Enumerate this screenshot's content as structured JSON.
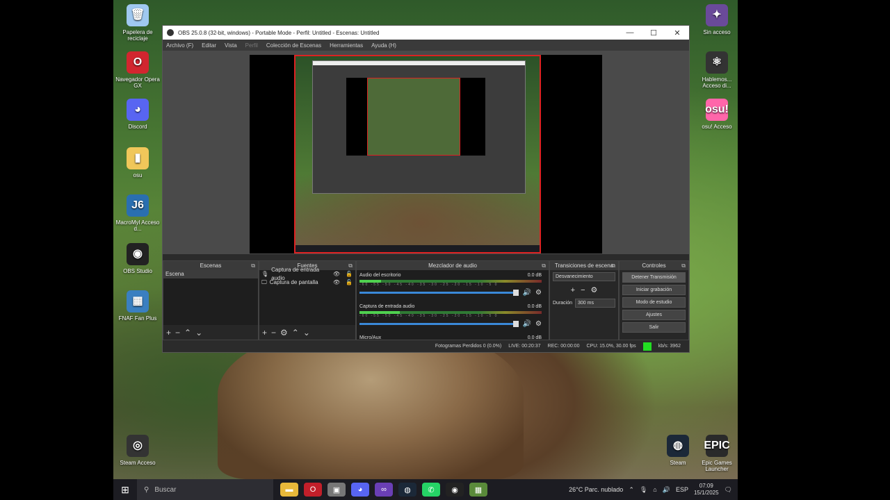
{
  "desktop": {
    "icons_left": [
      {
        "label": "Papelera de reciclaje",
        "icon": "recycle-bin-icon",
        "color": "#9fc8f0",
        "glyph": "🗑"
      },
      {
        "label": "Navegador Opera GX",
        "icon": "opera-icon",
        "color": "#d2262f",
        "glyph": "O"
      },
      {
        "label": "Discord",
        "icon": "discord-icon",
        "color": "#5865f2",
        "glyph": "◕"
      },
      {
        "label": "osu",
        "icon": "folder-icon",
        "color": "#f0c75a",
        "glyph": "▮"
      },
      {
        "label": "MacroMyl Acceso d...",
        "icon": "macro-app-icon",
        "color": "#2a6fb0",
        "glyph": "J6"
      },
      {
        "label": "OBS Studio",
        "icon": "obs-icon",
        "color": "#222222",
        "glyph": "◉"
      },
      {
        "label": "FNAF Fan Plus",
        "icon": "game-icon",
        "color": "#3a7fc0",
        "glyph": "▦"
      },
      {
        "label": "Steam Acceso",
        "icon": "user-circle-icon",
        "color": "#333333",
        "glyph": "◎"
      }
    ],
    "icons_right": [
      {
        "label": "Sin acceso",
        "icon": "app-icon",
        "color": "#6a4a9a",
        "glyph": "✦"
      },
      {
        "label": "Hablemos... Acceso di...",
        "icon": "atom-icon",
        "color": "#333333",
        "glyph": "⚛"
      },
      {
        "label": "osu! Acceso",
        "icon": "osu-icon",
        "color": "#ff66aa",
        "glyph": "osu!"
      },
      {
        "label": "Steam",
        "icon": "steam-icon",
        "color": "#1b2838",
        "glyph": "◍"
      },
      {
        "label": "Epic Games Launcher",
        "icon": "epic-games-icon",
        "color": "#2a2a2a",
        "glyph": "EPIC"
      }
    ]
  },
  "obs": {
    "title": "OBS 25.0.8 (32-bit, windows) - Portable Mode - Perfil: Untitled - Escenas: Untitled",
    "window_controls": [
      "—",
      "☐",
      "✕"
    ],
    "menu": [
      "Archivo (F)",
      "Editar",
      "Vista",
      "Perfil",
      "Colección de Escenas",
      "Herramientas",
      "Ayuda (H)"
    ],
    "docks": {
      "scenes": {
        "title": "Escenas",
        "items": [
          "Escena"
        ]
      },
      "sources": {
        "title": "Fuentes",
        "items": [
          "Captura de entrada audio",
          "Captura de pantalla"
        ]
      },
      "mixer": {
        "title": "Mezclador de audio",
        "channels": [
          {
            "name": "Audio del escritorio",
            "db": "0.0 dB",
            "level": 0.12
          },
          {
            "name": "Captura de entrada audio",
            "db": "0.0 dB",
            "level": 0.22
          },
          {
            "name": "Micro/Aux",
            "db": "0.0 dB",
            "level": 0.0
          }
        ],
        "ticks": "-60 -55 -50 -45 -40 -35 -30 -25 -20 -15 -10 -5 0"
      },
      "transitions": {
        "title": "Transiciones de escena",
        "type": "Desvanecimiento",
        "duration_label": "Duración",
        "duration": "300 ms"
      },
      "controls": {
        "title": "Controles",
        "buttons": [
          "Detener Transmisión",
          "Iniciar grabación",
          "Modo de estudio",
          "Ajustes",
          "Salir"
        ]
      }
    },
    "status": {
      "dropped": "Fotogramas Perdidos 0 (0.0%)",
      "live": "LIVE: 00:20:37",
      "rec": "REC: 00:00:00",
      "cpu": "CPU: 15.0%, 30.00 fps",
      "kbps": "kb/s: 3962",
      "indicator_color": "#22dd22"
    }
  },
  "taskbar": {
    "start": "⊞",
    "search_placeholder": "Buscar",
    "apps": [
      {
        "icon": "file-explorer-icon",
        "color": "#e8b83a",
        "glyph": "▬"
      },
      {
        "icon": "opera-taskbar-icon",
        "color": "#c21f2a",
        "glyph": "O"
      },
      {
        "icon": "app-taskbar-icon",
        "color": "#777777",
        "glyph": "▣"
      },
      {
        "icon": "discord-taskbar-icon",
        "color": "#5865f2",
        "glyph": "◕"
      },
      {
        "icon": "visual-studio-icon",
        "color": "#6a3fb5",
        "glyph": "∞"
      },
      {
        "icon": "steam-taskbar-icon",
        "color": "#1b2838",
        "glyph": "◍"
      },
      {
        "icon": "whatsapp-icon",
        "color": "#25d366",
        "glyph": "✆"
      },
      {
        "icon": "obs-taskbar-icon",
        "color": "#222222",
        "glyph": "◉"
      },
      {
        "icon": "minecraft-icon",
        "color": "#5a8a3a",
        "glyph": "▦"
      }
    ],
    "weather": "26°C  Parc. nublado",
    "lang": "ESP",
    "time": "07:09",
    "date": "15/1/2025"
  }
}
